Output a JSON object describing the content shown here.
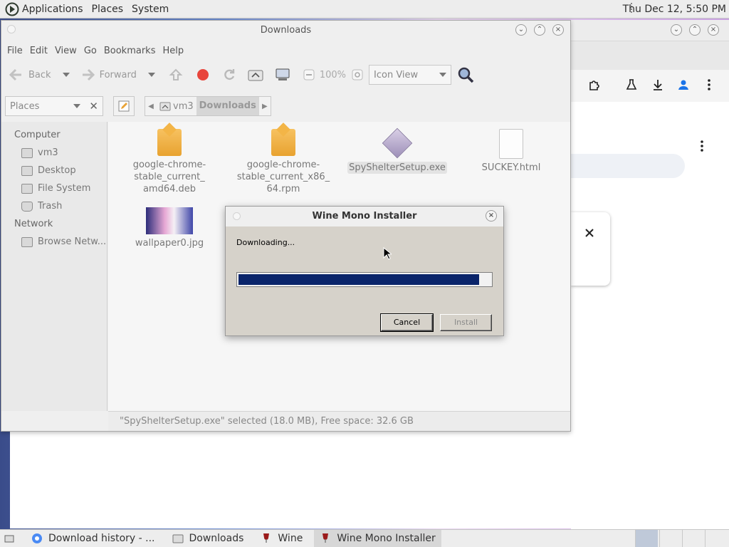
{
  "top_panel": {
    "menus": [
      "Applications",
      "Places",
      "System"
    ],
    "clock": "Thu Dec 12,  5:50 PM"
  },
  "file_manager": {
    "title": "Downloads",
    "menu": [
      "File",
      "Edit",
      "View",
      "Go",
      "Bookmarks",
      "Help"
    ],
    "toolbar": {
      "back": "Back",
      "forward": "Forward",
      "zoom": "100%",
      "view_mode": "Icon View"
    },
    "places_combo": "Places",
    "breadcrumb": [
      "vm3",
      "Downloads"
    ],
    "sidebar": {
      "computer_header": "Computer",
      "computer_items": [
        "vm3",
        "Desktop",
        "File System",
        "Trash"
      ],
      "network_header": "Network",
      "network_items": [
        "Browse Netw..."
      ]
    },
    "files": [
      {
        "name": "google-chrome-stable_current_amd64.deb",
        "lines": [
          "google-chrome-",
          "stable_current_",
          "amd64.deb"
        ],
        "icon": "package-icon"
      },
      {
        "name": "google-chrome-stable_current_x86_64.rpm",
        "lines": [
          "google-chrome-",
          "stable_current_x86_",
          "64.rpm"
        ],
        "icon": "package-icon"
      },
      {
        "name": "SpyShelterSetup.exe",
        "lines": [
          "SpyShelterSetup.exe"
        ],
        "icon": "wine-exe-icon",
        "selected": true
      },
      {
        "name": "SUCKEY.html",
        "lines": [
          "SUCKEY.html"
        ],
        "icon": "html-file-icon"
      },
      {
        "name": "wallpaper0.jpg",
        "lines": [
          "wallpaper0.jpg"
        ],
        "icon": "image-thumbnail"
      }
    ],
    "status": "\"SpyShelterSetup.exe\" selected (18.0 MB), Free space: 32.6 GB"
  },
  "dialog": {
    "title": "Wine Mono Installer",
    "status": "Downloading...",
    "progress": 0.955,
    "progress_color": "#0a246a",
    "cancel_label": "Cancel",
    "install_label": "Install"
  },
  "taskbar": {
    "tasks": [
      {
        "label": "Download history - ...",
        "icon": "chrome-icon"
      },
      {
        "label": "Downloads",
        "icon": "folder-icon"
      },
      {
        "label": "Wine",
        "icon": "wine-icon"
      },
      {
        "label": "Wine Mono Installer",
        "icon": "wine-icon",
        "active": true
      }
    ]
  },
  "colors": {
    "panel": "#ededed",
    "selection_fill": "#0a246a"
  }
}
